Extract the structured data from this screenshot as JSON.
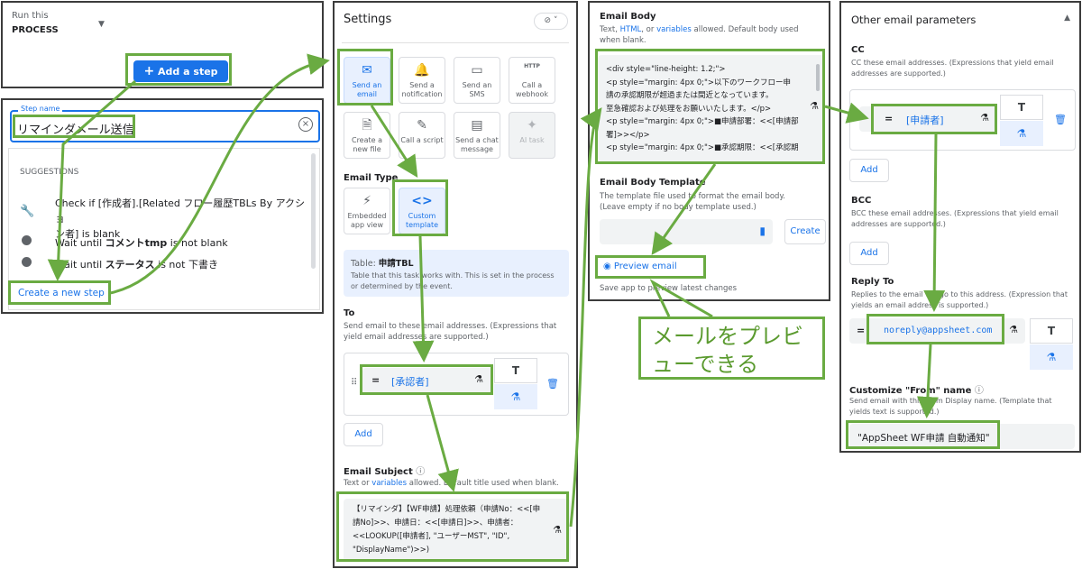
{
  "panel1": {
    "run_label": "Run this",
    "process_label": "PROCESS",
    "add_step": "Add a step"
  },
  "panel2": {
    "field_label": "Step name",
    "field_value": "リマインダメール送信",
    "suggestions_header": "SUGGESTIONS",
    "suggestion1_a": "Check if [作成者].[Related フロー履歴TBLs By アクショ",
    "suggestion1_b": "ン者] is blank",
    "suggestion2_pre": "Wait until ",
    "suggestion2_bold": "コメントtmp",
    "suggestion2_post": " is not blank",
    "suggestion3_pre": "Wait until ",
    "suggestion3_bold": "ステータス",
    "suggestion3_post": " is not 下書き",
    "create_step": "Create a new step"
  },
  "settings": {
    "title": "Settings",
    "tasks": [
      {
        "label": "Send an email",
        "icon": "email-icon"
      },
      {
        "label": "Send a notification",
        "icon": "bell-icon"
      },
      {
        "label": "Send an SMS",
        "icon": "chat-icon"
      },
      {
        "label": "Call a webhook",
        "icon": "http-icon"
      },
      {
        "label": "Create a new file",
        "icon": "file-icon"
      },
      {
        "label": "Call a script",
        "icon": "script-icon"
      },
      {
        "label": "Send a chat message",
        "icon": "message-icon"
      },
      {
        "label": "AI task",
        "icon": "sparkle-icon"
      }
    ],
    "email_type_label": "Email Type",
    "type_embedded": "Embedded app view",
    "type_custom": "Custom template",
    "table_prefix": "Table: ",
    "table_name": "申請TBL",
    "table_desc": "Table that this task works with. This is set in the process or determined by the event.",
    "to_label": "To",
    "to_desc": "Send email to these email addresses. (Expressions that yield email addresses are supported.)",
    "to_value": "[承認者]",
    "add": "Add",
    "subject_label": "Email Subject",
    "subject_desc_pre": "Text or ",
    "subject_desc_link": "variables",
    "subject_desc_post": " allowed. Default title used when blank.",
    "subject_value": "【リマインダ】【WF申請】処理依頼（申請No：<<[申請No]>>、申請日：<<[申請日]>>、申請者：<<LOOKUP([申請者], \"ユーザーMST\", \"ID\", \"DisplayName\")>>)"
  },
  "body_panel": {
    "title": "Email Body",
    "desc_pre": "Text, ",
    "desc_html": "HTML",
    "desc_mid": ", or ",
    "desc_vars": "variables",
    "desc_post": " allowed. Default body used when blank.",
    "body_lines": [
      "<div style=\"line-height: 1.2;\">",
      "<p style=\"margin: 4px 0;\">以下のワークフロー申",
      "請の承認期限が超過または間近となっています。",
      "至急確認および処理をお願いいたします。</p>",
      "<p style=\"margin: 4px 0;\">■申請部署：<<[申請部",
      "署]>></p>",
      "<p style=\"margin: 4px 0;\">■承認期限：<<[承認期"
    ],
    "template_title": "Email Body Template",
    "template_desc": "The template file used to format the email body. (Leave empty if no body template used.)",
    "create": "Create",
    "preview": "Preview email",
    "save_note": "Save app to preview latest changes",
    "callout": "メールをプレビューできる"
  },
  "params": {
    "title": "Other email parameters",
    "cc_label": "CC",
    "cc_desc": "CC these email addresses. (Expressions that yield email addresses are supported.)",
    "cc_value": "[申請者]",
    "bcc_label": "BCC",
    "bcc_desc": "BCC these email addresses. (Expressions that yield email addresses are supported.)",
    "reply_label": "Reply To",
    "reply_desc": "Replies to the email will go to this address. (Expression that yields an email address is supported.)",
    "reply_value": "noreply@appsheet.com",
    "from_label": "Customize \"From\" name",
    "from_desc": "Send email with this From Display name. (Template that yields text is supported.)",
    "from_value": "\"AppSheet WF申請 自動通知\"",
    "add": "Add"
  },
  "colors": {
    "accent": "#1a73e8",
    "highlight": "#6aab42",
    "callout_text": "#5a9a2e"
  }
}
